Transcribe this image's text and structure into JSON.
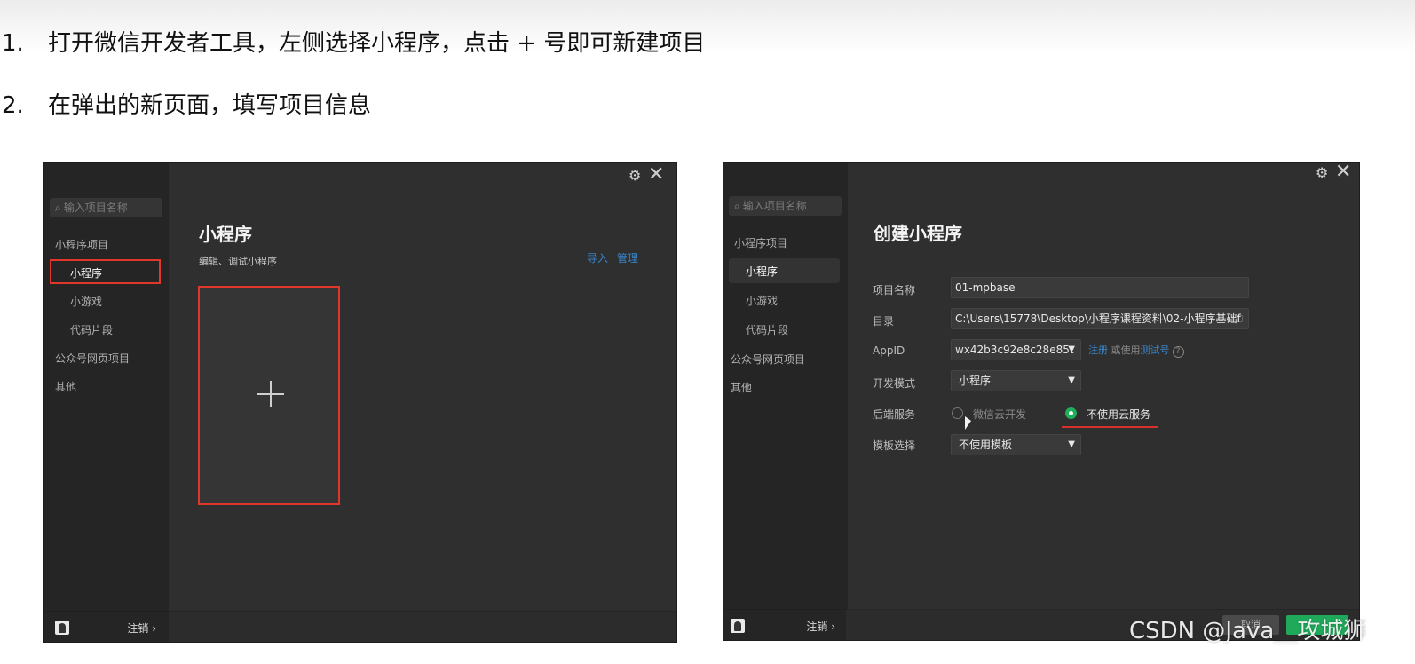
{
  "instructions": {
    "step1": {
      "num": "1.",
      "text": "打开微信开发者工具，左侧选择小程序，点击 + 号即可新建项目"
    },
    "step2": {
      "num": "2.",
      "text": "在弹出的新页面，填写项目信息"
    }
  },
  "left_window": {
    "search_placeholder": "输入项目名称",
    "sidebar": {
      "group1": "小程序项目",
      "items": [
        "小程序",
        "小游戏",
        "代码片段"
      ],
      "group2": "公众号网页项目",
      "group3": "其他"
    },
    "footer_logout": "注销 ›",
    "title": "小程序",
    "subtitle": "编辑、调试小程序",
    "links": {
      "import": "导入",
      "manage": "管理"
    },
    "new_project_symbol": "+"
  },
  "right_window": {
    "search_placeholder": "输入项目名称",
    "sidebar": {
      "group1": "小程序项目",
      "items": [
        "小程序",
        "小游戏",
        "代码片段"
      ],
      "group2": "公众号网页项目",
      "group3": "其他"
    },
    "footer_logout": "注销 ›",
    "title": "创建小程序",
    "form": {
      "project_name_label": "项目名称",
      "project_name_value": "01-mpbase",
      "directory_label": "目录",
      "directory_value": "C:\\Users\\15778\\Desktop\\小程序课程资料\\02-小程序基础f",
      "appid_label": "AppID",
      "appid_value": "wx42b3c92e8c28e85t",
      "appid_register": "注册",
      "appid_or": "或使用",
      "appid_test": "测试号",
      "dev_mode_label": "开发模式",
      "dev_mode_value": "小程序",
      "backend_label": "后端服务",
      "backend_option1": "微信云开发",
      "backend_option2": "不使用云服务",
      "template_label": "模板选择",
      "template_value": "不使用模板"
    },
    "footer_gray_btn": "取消"
  },
  "watermark": "CSDN @Java__攻城狮",
  "colors": {
    "highlight_red": "#e0362b",
    "link_blue": "#3a84c9",
    "green": "#1fae5a",
    "panel_bg": "#2f2f2f"
  }
}
